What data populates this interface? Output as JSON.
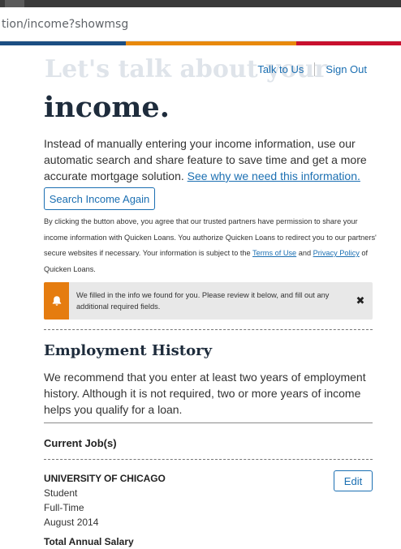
{
  "browser": {
    "url": "tion/income?showmsg"
  },
  "header": {
    "ghost_heading": "Let's talk about your",
    "nav_talk": "Talk to Us",
    "nav_signout": "Sign Out"
  },
  "page": {
    "heading": "income.",
    "intro_text": "Instead of manually entering your income information, use our automatic search and share feature to save time and get a more accurate mortgage solution. ",
    "intro_link": "See why we need this information.",
    "search_button": "Search Income Again",
    "disclaimer_1": "By clicking the button above, you agree that our trusted partners have permission to share your income information with Quicken Loans. You authorize Quicken Loans to redirect you to our partners' secure websites if necessary. Your information is subject to the ",
    "terms_link": "Terms of Use",
    "disclaimer_and": " and ",
    "privacy_link": "Privacy Policy",
    "disclaimer_2": " of Quicken Loans."
  },
  "alert": {
    "icon": "bell-icon",
    "message": "We filled in the info we found for you. Please review it below, and fill out any additional required fields.",
    "close_icon": "close-icon",
    "close_glyph": "✖",
    "color": "#e57c0f"
  },
  "employment": {
    "heading": "Employment History",
    "description": "We recommend that you enter at least two years of employment history. Although it is not required, two or more years of income helps you qualify for a loan.",
    "jobs_heading": "Current Job(s)",
    "job": {
      "company": "UNIVERSITY OF CHICAGO",
      "title": "Student",
      "type": "Full-Time",
      "start": "August 2014",
      "edit_label": "Edit"
    },
    "salary_heading": "Total Annual Salary"
  },
  "colors": {
    "accent_blue": "#1b6fb2",
    "heading_navy": "#1e2c3c",
    "stripe_blue": "#1c4e82",
    "stripe_orange": "#e8890c",
    "stripe_red": "#c8102e"
  }
}
